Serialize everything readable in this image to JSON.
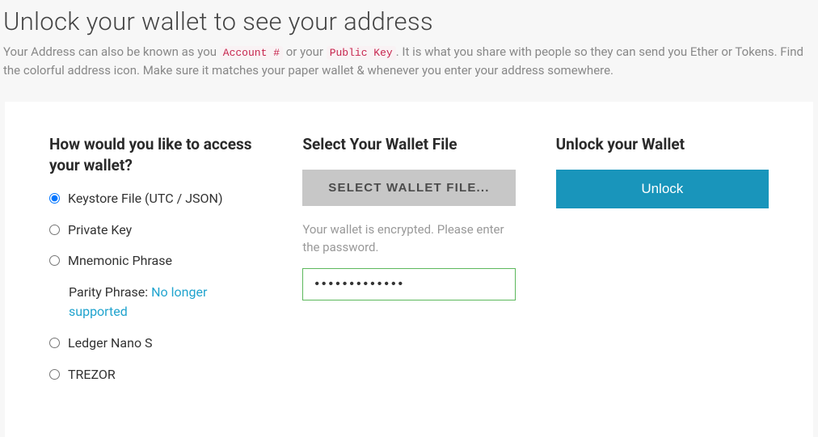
{
  "header": {
    "title": "Unlock your wallet to see your address",
    "desc_1": "Your Address can also be known as you ",
    "desc_code_1": "Account #",
    "desc_2": " or your ",
    "desc_code_2": "Public Key",
    "desc_3": ". It is what you share with people so they can send you Ether or Tokens. Find the colorful address icon. Make sure it matches your paper wallet & whenever you enter your address somewhere."
  },
  "access": {
    "heading": "How would you like to access your wallet?",
    "options": {
      "keystore": "Keystore File (UTC / JSON)",
      "private_key": "Private Key",
      "mnemonic": "Mnemonic Phrase",
      "parity_prefix": "Parity Phrase: ",
      "parity_link": "No longer supported",
      "ledger": "Ledger Nano S",
      "trezor": "TREZOR"
    }
  },
  "file": {
    "heading": "Select Your Wallet File",
    "button_label": "SELECT WALLET FILE...",
    "helper": "Your wallet is encrypted. Please enter the password.",
    "password_value": "•••••••••••••"
  },
  "unlock": {
    "heading": "Unlock your Wallet",
    "button_label": "Unlock"
  }
}
